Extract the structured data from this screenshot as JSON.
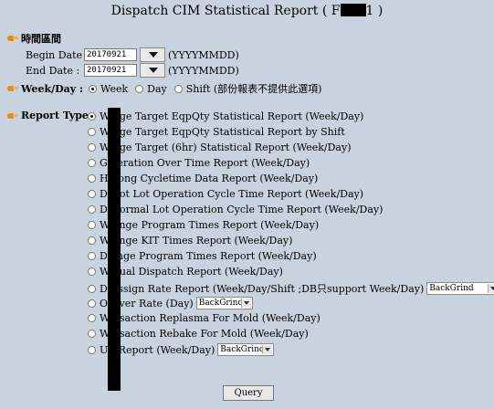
{
  "title": {
    "prefix": "Dispatch CIM Statistical Report ( F",
    "suffix": "1 )"
  },
  "time_section": {
    "label": "時間區間"
  },
  "begin": {
    "label": "Begin Date :",
    "value": "20170921",
    "format": "(YYYYMMDD)"
  },
  "end": {
    "label": "End Date :",
    "value": "20170921",
    "format": "(YYYYMMDD)"
  },
  "period": {
    "label": "Week/Day :",
    "options": [
      "Week",
      "Day",
      "Shift (部份報表不提供此選項)"
    ],
    "selected": "Week"
  },
  "report_type": {
    "label": "Report Type :",
    "items": [
      "W           nge Target EqpQty Statistical Report (Week/Day)",
      "W           nge Target EqpQty Statistical Report by Shift",
      "W           nge Target (6hr) Statistical Report (Week/Day)",
      "G           peration Over Time Report (Week/Day)",
      "H           Long Cycletime Data Report (Week/Day)",
      "D           Hot Lot Operation Cycle Time Report (Week/Day)",
      "D           Normal Lot Operation Cycle Time Report (Week/Day)",
      "W           ange Program Times Report (Week/Day)",
      "W           ange KIT Times Report (Week/Day)",
      "D           ange Program Times Report (Week/Day)",
      "W           nual Dispatch Report (Week/Day)",
      "D           Assign Rate Report (Week/Day/Shift ;DB只support Week/Day)",
      "O           Over Rate (Day)",
      "W           nsaction Replasma For Mold (Week/Day)",
      "W           nsaction Rebake For Mold (Week/Day)",
      "U           t Report (Week/Day)"
    ],
    "selected_index": 0,
    "dropdowns": {
      "assign_rate": "BackGrind",
      "over_rate": "BackGrind",
      "report_last": "BackGrind"
    }
  },
  "query_button": "Query"
}
